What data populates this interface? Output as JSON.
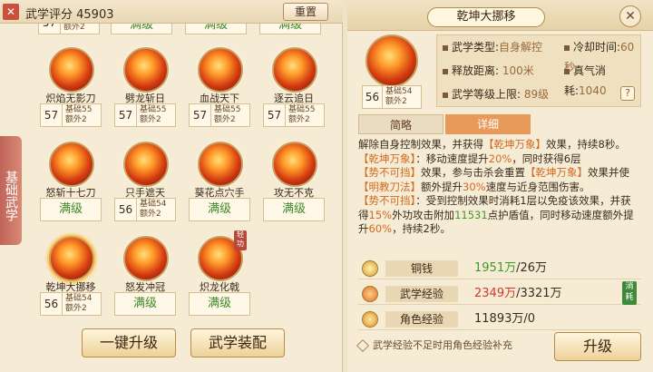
{
  "left": {
    "score_label": "武学评分 45903",
    "reset_label": "重置",
    "side_tab": "基础武学",
    "skills": [
      {
        "name": "炽焰无影刀",
        "level": "57",
        "b1": "基础55",
        "b2": "额外2",
        "maxed": ""
      },
      {
        "name": "劈龙斩日",
        "level": "57",
        "b1": "基础55",
        "b2": "额外2",
        "maxed": ""
      },
      {
        "name": "血战天下",
        "level": "57",
        "b1": "基础55",
        "b2": "额外2",
        "maxed": ""
      },
      {
        "name": "逐云追日",
        "level": "57",
        "b1": "基础55",
        "b2": "额外2",
        "maxed": ""
      },
      {
        "name": "怒斩十七刀",
        "level": "",
        "b1": "",
        "b2": "",
        "maxed": "满级"
      },
      {
        "name": "只手遮天",
        "level": "56",
        "b1": "基础54",
        "b2": "额外2",
        "maxed": ""
      },
      {
        "name": "葵花点穴手",
        "level": "",
        "b1": "",
        "b2": "",
        "maxed": "满级"
      },
      {
        "name": "攻无不克",
        "level": "",
        "b1": "",
        "b2": "",
        "maxed": "满级"
      },
      {
        "name": "乾坤大挪移",
        "level": "56",
        "b1": "基础54",
        "b2": "额外2",
        "maxed": ""
      },
      {
        "name": "怒发冲冠",
        "level": "",
        "b1": "",
        "b2": "",
        "maxed": "满级"
      },
      {
        "name": "炽龙化戟",
        "level": "",
        "b1": "",
        "b2": "",
        "maxed": "满级",
        "badge": "轻功"
      }
    ],
    "top_partial": {
      "a": "57",
      "b": "额外2",
      "c": "满级",
      "d": "满级",
      "e": "满级"
    },
    "btn_upgrade_all": "一键升级",
    "btn_equip": "武学装配"
  },
  "right": {
    "title": "乾坤大挪移",
    "level": "56",
    "b1": "基础54",
    "b2": "额外2",
    "type_label": "武学类型:",
    "type_val": "自身解控",
    "cd_label": "冷却时间:",
    "cd_val": "60秒",
    "range_label": "释放距离:",
    "range_val": "100米",
    "mp_label": "真气消耗:",
    "mp_val": "1040",
    "cap_label": "武学等级上限:",
    "cap_val": "89级",
    "tab_brief": "简略",
    "tab_detail": "详细",
    "desc1": "解除自身控制效果，并获得",
    "desc1o": "【乾坤万象】",
    "desc1b": "效果，持续8秒。",
    "desc2o": "【乾坤万象】",
    "desc2a": "：移动速度提升",
    "desc2v": "20%",
    "desc2b": "，同时获得6层",
    "desc2o2": "【势不可挡】",
    "desc2c": "效果，参与击杀会重置",
    "desc2o3": "【乾坤万象】",
    "desc2d": "效果并使",
    "desc2o4": "【明教刀法】",
    "desc2e": "额外提升",
    "desc2v2": "30%",
    "desc2f": "速度与近身范围伤害。",
    "desc3o": "【势不可挡】",
    "desc3a": "：受到控制效果时消耗1层以免疫该效果，并获得",
    "desc3v": "15%",
    "desc3b": "外功攻击附加",
    "desc3v2": "11531",
    "desc3c": "点护盾值，同时移动速度额外提升",
    "desc3v3": "60%",
    "desc3d": "，持续2秒。",
    "cost": [
      {
        "name": "铜钱",
        "val_a": "1951万",
        "val_b": "/26万",
        "color": "#3e9a2a"
      },
      {
        "name": "武学经验",
        "val_a": "2349万",
        "val_b": "/3321万",
        "color": "#d03a2a"
      },
      {
        "name": "角色经验",
        "val_a": "11893万",
        "val_b": "/0",
        "color": "#3a2a1a"
      }
    ],
    "consume_badge": "消耗",
    "note": "武学经验不足时用角色经验补充",
    "upgrade_btn": "升级"
  }
}
